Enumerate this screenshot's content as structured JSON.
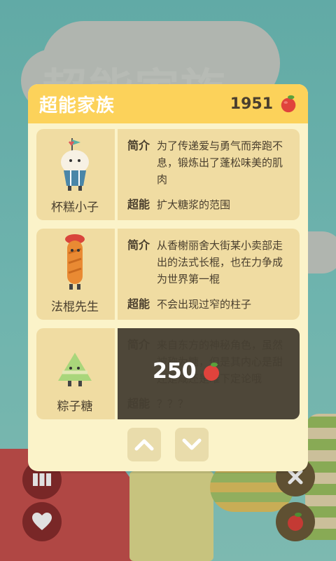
{
  "background": {
    "title": "超能家族"
  },
  "dialog": {
    "title": "超能家族",
    "coins": "1951",
    "intro_label": "简介",
    "super_label": "超能",
    "characters": [
      {
        "name": "杯糕小子",
        "intro": "为了传递爱与勇气而奔跑不息，锻炼出了蓬松味美的肌肉",
        "super": "扩大糖浆的范围",
        "locked": false
      },
      {
        "name": "法棍先生",
        "intro": "从香榭丽舍大街某小卖部走出的法式长棍，也在力争成为世界第一棍",
        "super": "不会出现过窄的柱子",
        "locked": false
      },
      {
        "name": "粽子糖",
        "intro": "来自东方的神秘角色，虽然被称为糖，但是其内心是甜还是咸还是难下定论哦",
        "super": "？？？",
        "locked": true,
        "unlock_cost": "250"
      }
    ]
  },
  "nav": {
    "up_icon": "chevron-up-icon",
    "down_icon": "chevron-down-icon"
  },
  "colors": {
    "header": "#fcd25a",
    "panel": "#fbf3c9",
    "card": "#f0dca2",
    "locked": "#4e4739"
  }
}
